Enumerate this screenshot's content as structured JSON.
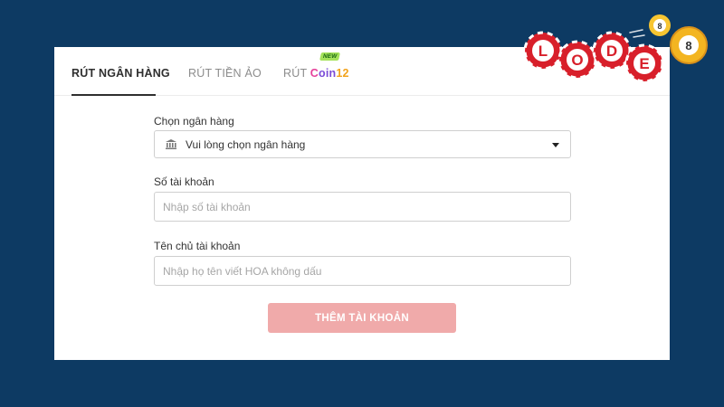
{
  "tabs": {
    "bank": "RÚT NGÂN HÀNG",
    "virtual": "RÚT TIỀN ẢO",
    "coin_prefix": "RÚT",
    "coin_c": "C",
    "coin_oin": "oin",
    "coin_num": "12",
    "new_badge": "NEW"
  },
  "form": {
    "bank_label": "Chọn ngân hàng",
    "bank_select_value": "Vui lòng chọn ngân hàng",
    "account_label": "Số tài khoản",
    "account_placeholder": "Nhập số tài khoản",
    "name_label": "Tên chủ tài khoản",
    "name_placeholder": "Nhập họ tên viết HOA không dấu",
    "submit_label": "THÊM TÀI KHOẢN"
  },
  "logo": {
    "letters": [
      "L",
      "O",
      "D",
      "E"
    ],
    "ball_numbers": [
      "8",
      "8"
    ]
  },
  "colors": {
    "background": "#0d3a63",
    "button": "#f0aaaa",
    "logo_red": "#d81f2a"
  },
  "icons": {
    "bank": "bank-icon",
    "dropdown": "caret-down-icon"
  }
}
